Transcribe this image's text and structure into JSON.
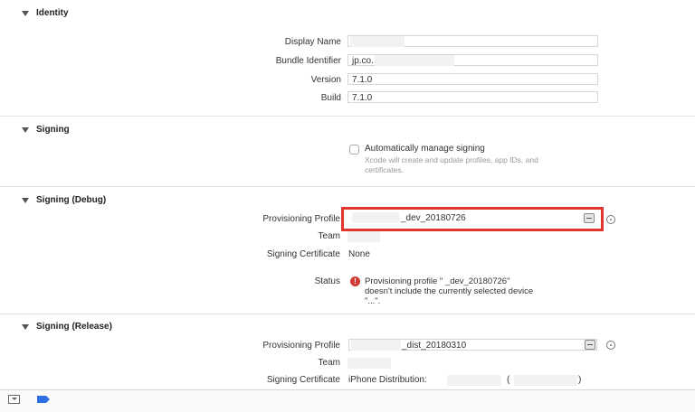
{
  "identity": {
    "title": "Identity",
    "display_name_label": "Display Name",
    "display_name_value": "",
    "bundle_id_label": "Bundle Identifier",
    "bundle_id_value": "jp.co.",
    "version_label": "Version",
    "version_value": "7.1.0",
    "build_label": "Build",
    "build_value": "7.1.0"
  },
  "signing": {
    "title": "Signing",
    "auto_manage_label": "Automatically manage signing",
    "auto_manage_checked": false,
    "auto_manage_hint_line1": "Xcode will create and update profiles, app IDs, and",
    "auto_manage_hint_line2": "certificates."
  },
  "signing_debug": {
    "title": "Signing (Debug)",
    "profile_label": "Provisioning Profile",
    "profile_value": "_dev_20180726",
    "team_label": "Team",
    "team_value": "",
    "cert_label": "Signing Certificate",
    "cert_value": "None",
    "status_label": "Status",
    "status_line1": "Provisioning profile \"              _dev_20180726\"",
    "status_line2": "doesn't include the currently selected device",
    "status_line3": "\"...\".",
    "highlight_color": "#e0342c",
    "error_color": "#d23a35"
  },
  "signing_release": {
    "title": "Signing (Release)",
    "profile_label": "Provisioning Profile",
    "profile_value": "_dist_20180310",
    "team_label": "Team",
    "team_value": "",
    "cert_label": "Signing Certificate",
    "cert_value": "iPhone Distribution:",
    "cert_paren_open": "(",
    "cert_paren_close": ")"
  },
  "bottom_bar": {
    "icons": [
      "tray-icon",
      "tag-icon"
    ],
    "accent": "#2f6fe4"
  }
}
